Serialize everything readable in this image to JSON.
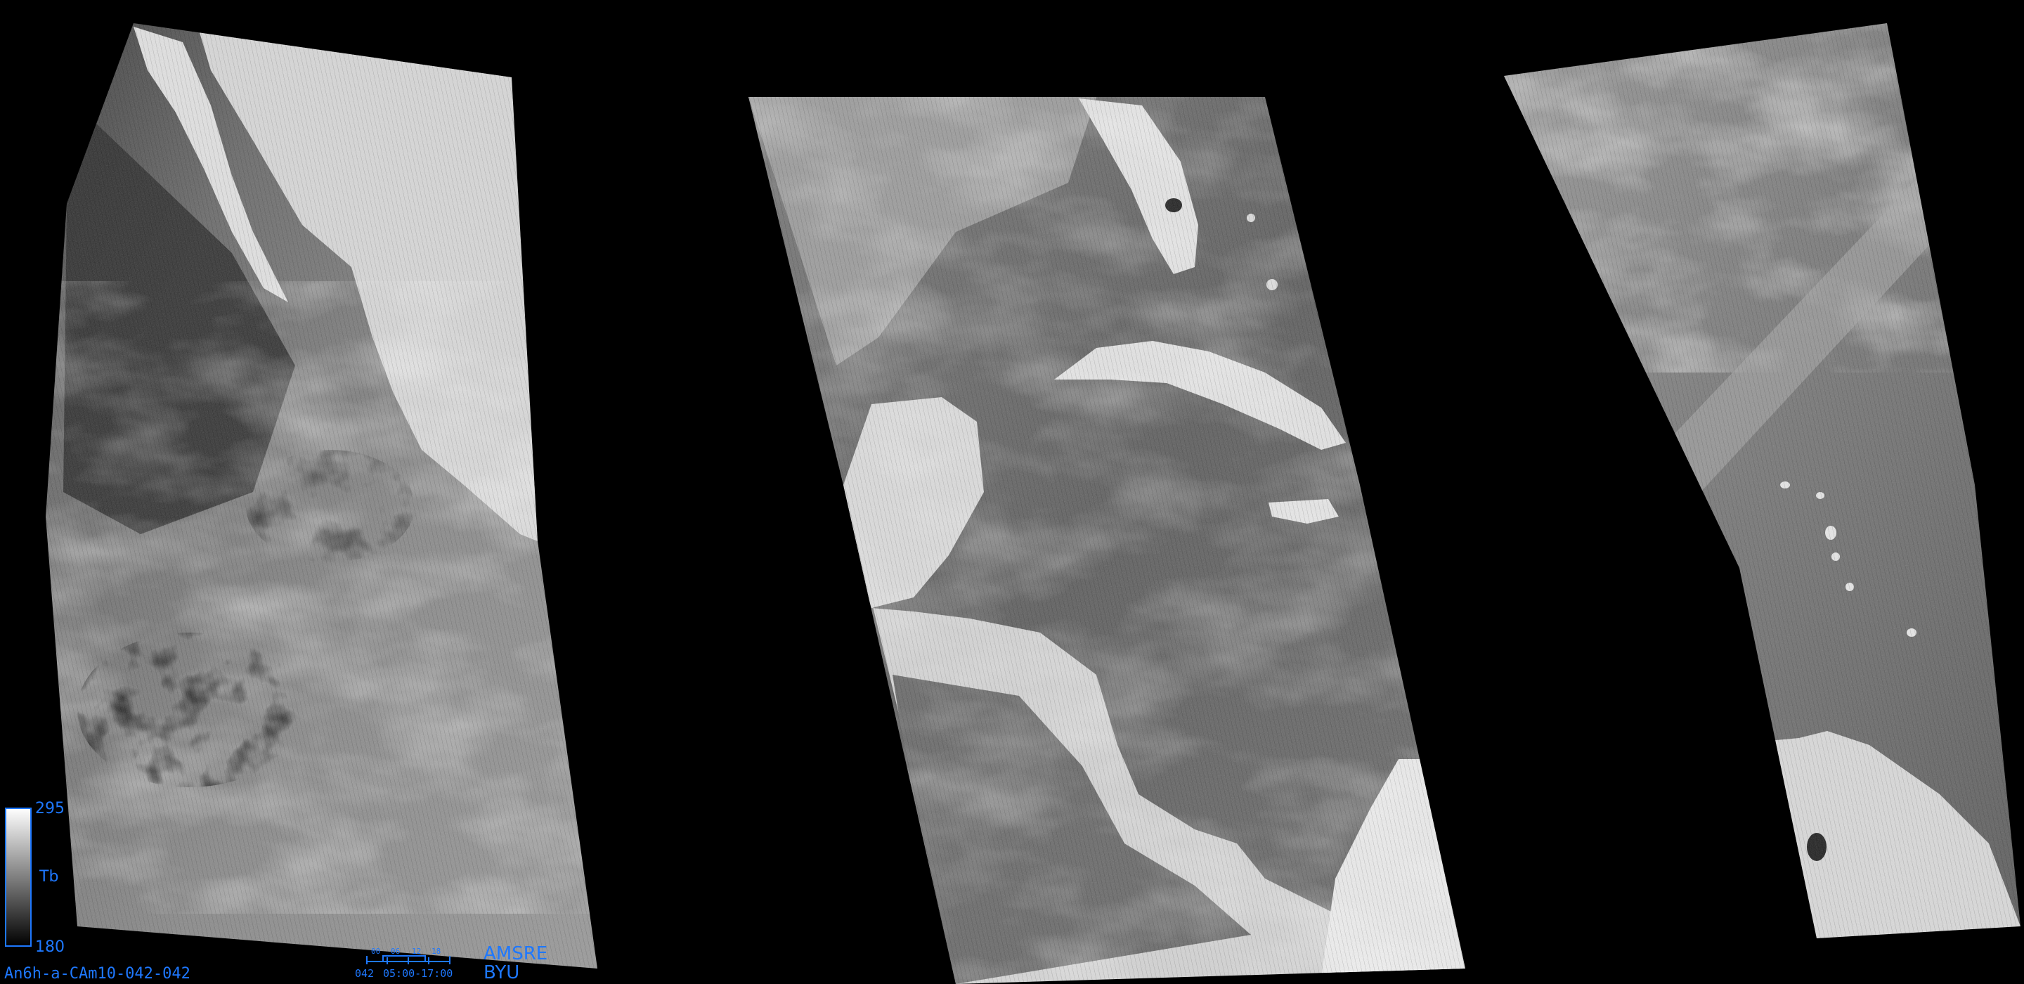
{
  "image": {
    "product_id": "An6h-a-CAm10-042-042",
    "sensor": "AMSRE",
    "institution": "BYU"
  },
  "colorbar": {
    "max": "295",
    "min": "180",
    "variable": "Tb"
  },
  "time_indicator": {
    "day": "042",
    "time_range": "05:00-17:00",
    "tick_labels": [
      "00",
      "06",
      "12",
      "18"
    ]
  },
  "colors": {
    "accent": "#1e78ff",
    "background": "#000000"
  }
}
